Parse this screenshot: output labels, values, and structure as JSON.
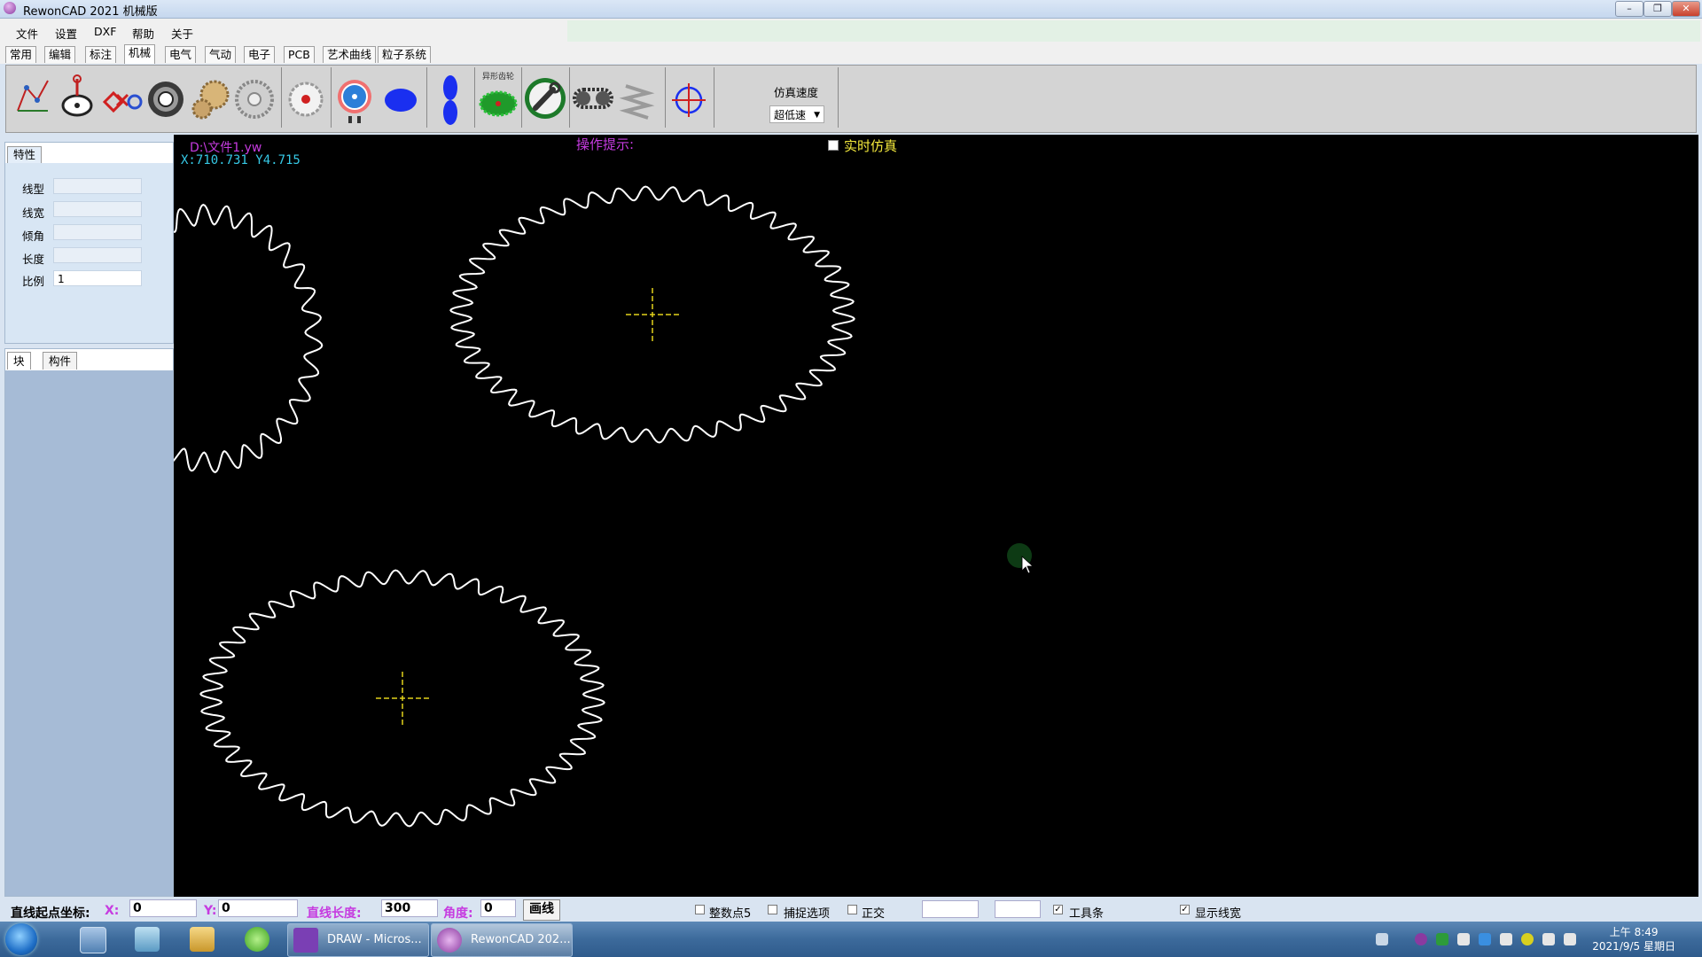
{
  "window": {
    "title": "RewonCAD 2021 机械版",
    "min": "–",
    "max": "❐",
    "close": "✕"
  },
  "menu": [
    "文件",
    "设置",
    "DXF",
    "帮助",
    "关于"
  ],
  "tabs": [
    "常用",
    "编辑",
    "标注",
    "机械",
    "电气",
    "气动",
    "电子",
    "PCB",
    "艺术曲线",
    "粒子系统"
  ],
  "active_tab": "机械",
  "toolbar": {
    "tools": [
      "linkage-tool-icon",
      "cam-tool-icon",
      "mechanism-tool-icon",
      "bearing-tool-icon",
      "gear-pair-tool-icon",
      "gear-tool-icon",
      "pulley-tool-icon",
      "sprocket-tool-icon",
      "ellipse-tool-icon",
      "double-ellipse-tool-icon",
      "noncircular-gear-tool-icon",
      "wrench-gear-tool-icon",
      "chain-tool-icon",
      "spring-tool-icon",
      "crosshair-tool-icon"
    ],
    "noncircular_label": "异形齿轮",
    "speed_label": "仿真速度",
    "speed_value": "超低速"
  },
  "properties": {
    "tab": "特性",
    "fields": [
      {
        "label": "线型",
        "value": ""
      },
      {
        "label": "线宽",
        "value": ""
      },
      {
        "label": "倾角",
        "value": ""
      },
      {
        "label": "长度",
        "value": ""
      },
      {
        "label": "比例",
        "value": "1"
      }
    ]
  },
  "block_panel": {
    "tabs": [
      "块",
      "构件"
    ]
  },
  "canvas": {
    "file_path": "D:\\文件1.yw",
    "coords": "X:710.731   Y4.715",
    "hint_label": "操作提示:",
    "realtime_label": "实时仿真",
    "colors": {
      "background": "#000000",
      "gear": "#ffffff",
      "center": "#e3d21a",
      "path": "#c63be0",
      "coords": "#36c9e6"
    }
  },
  "statusbar": {
    "start_label": "直线起点坐标:",
    "x_label": "X:",
    "x_value": "0",
    "y_label": "Y:",
    "y_value": "0",
    "length_label": "直线长度:",
    "length_value": "300",
    "angle_label": "角度:",
    "angle_value": "0",
    "draw_button": "画线",
    "options": [
      {
        "label": "整数点5",
        "checked": false
      },
      {
        "label": "捕捉选项",
        "checked": false
      },
      {
        "label": "正交",
        "checked": false
      },
      {
        "label": "工具条",
        "checked": true
      },
      {
        "label": "显示线宽",
        "checked": true
      }
    ]
  },
  "taskbar": {
    "apps": [
      "DRAW - Micros...",
      "RewonCAD 202..."
    ],
    "time": "上午 8:49",
    "date": "2021/9/5 星期日"
  }
}
